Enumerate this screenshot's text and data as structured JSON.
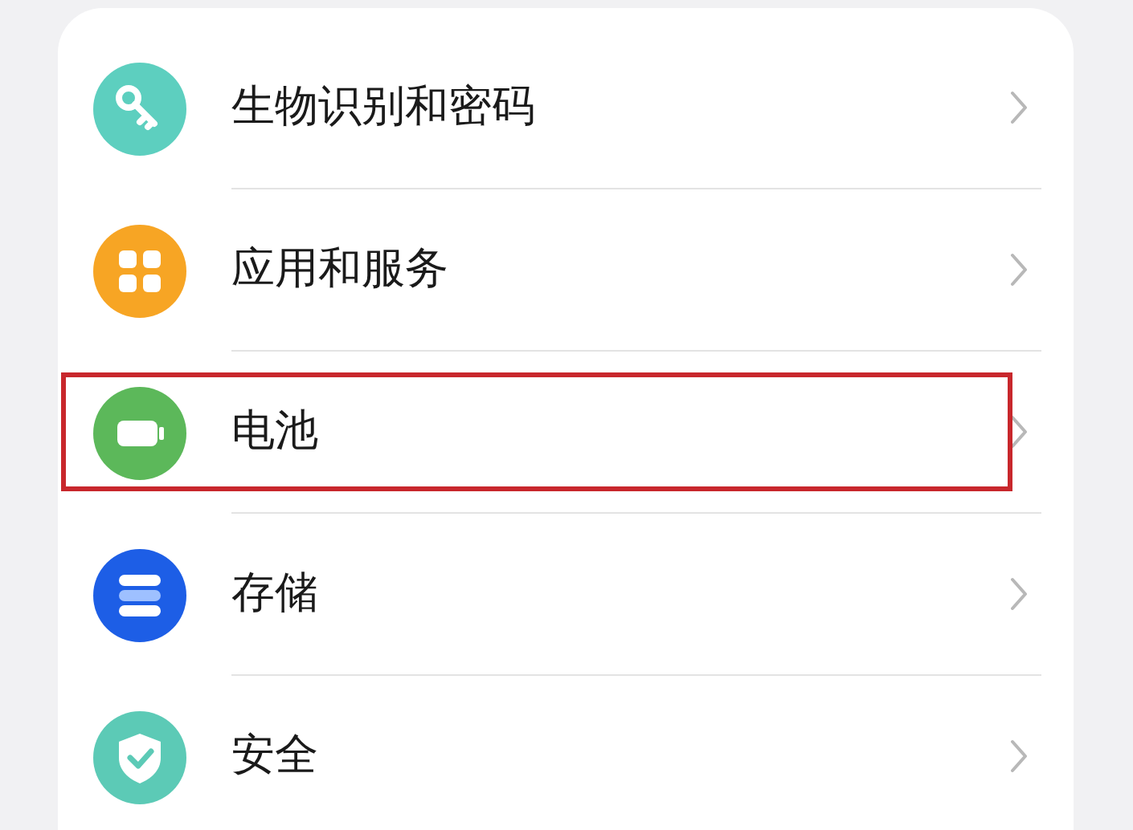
{
  "settings": [
    {
      "label": "生物识别和密码",
      "kind": "key",
      "color": "#5dcfbf",
      "highlighted": false
    },
    {
      "label": "应用和服务",
      "kind": "apps",
      "color": "#f7a524",
      "highlighted": false
    },
    {
      "label": "电池",
      "kind": "battery",
      "color": "#5cb85a",
      "highlighted": true
    },
    {
      "label": "存储",
      "kind": "storage",
      "color": "#1d5ee6",
      "highlighted": false
    },
    {
      "label": "安全",
      "kind": "shield",
      "color": "#5ccab6",
      "highlighted": false
    }
  ]
}
